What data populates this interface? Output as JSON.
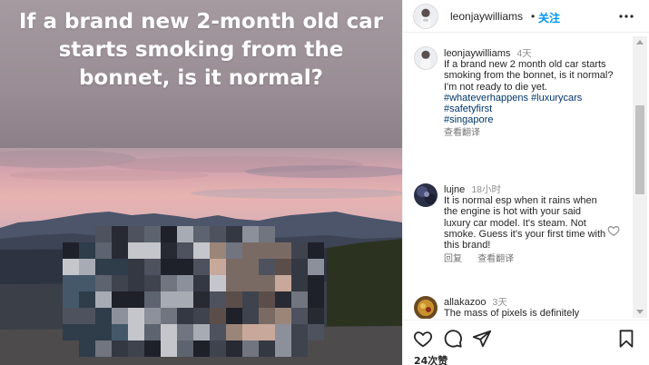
{
  "post": {
    "caption_overlay": "If a brand new 2-month old car starts smoking from the bonnet, is it normal?"
  },
  "header": {
    "username": "leonjaywilliams",
    "separator": "•",
    "follow_label": "关注"
  },
  "comments": [
    {
      "username": "leonjaywilliams",
      "time": "4天",
      "text": "If a brand new 2 month old car starts smoking from the bonnet, is it normal?\nI'm not ready to die yet.",
      "hashtags": [
        "#whateverhappens",
        "#luxurycars",
        "#safetyfirst",
        "#singapore"
      ],
      "actions": [
        "查看翻译"
      ]
    },
    {
      "username": "lujne",
      "time": "18小时",
      "text": "It is normal esp when it rains when the engine is hot with your said luxury car model. It's steam. Not smoke. Guess it's your first time with this brand!",
      "actions": [
        "回复",
        "查看翻译"
      ]
    },
    {
      "username": "allakazoo",
      "time": "3天",
      "text": "The mass of pixels is definitely"
    }
  ],
  "footer": {
    "likes": "24次赞"
  },
  "icons": {
    "more": "more-horizontal-icon",
    "like": "heart-icon",
    "comment": "comment-icon",
    "share": "send-icon",
    "save": "bookmark-icon"
  },
  "colors": {
    "accent": "#0095f6",
    "hashtag": "#00376b",
    "muted": "#8e8e8e"
  }
}
